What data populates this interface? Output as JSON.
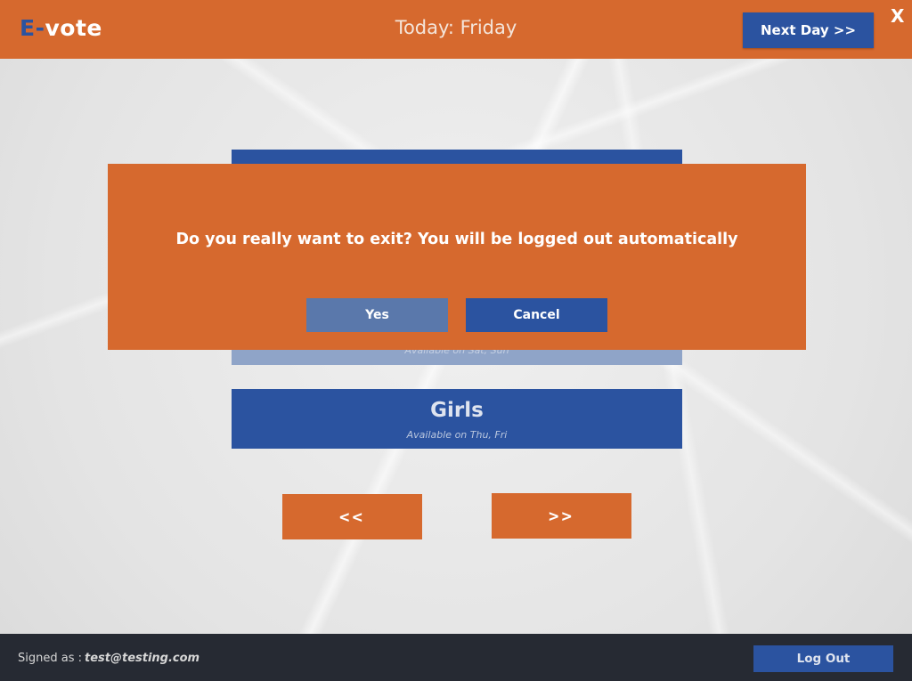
{
  "header": {
    "logo_prefix": "E",
    "logo_dash": "-",
    "logo_suffix": "vote",
    "today_label": "Today: Friday",
    "next_day_label": "Next Day >>",
    "close_label": "X"
  },
  "categories": {
    "top_partial": "",
    "faded_available": "Available on  Sat, Sun",
    "girls": {
      "title": "Girls",
      "available": "Available on  Thu, Fri"
    }
  },
  "nav": {
    "prev_label": "<<",
    "next_label": ">>"
  },
  "dialog": {
    "message": "Do you really want to exit? You will be logged out automatically",
    "yes_label": "Yes",
    "cancel_label": "Cancel"
  },
  "footer": {
    "signed_label": "Signed as :",
    "email": "test@testing.com",
    "logout_label": "Log Out"
  },
  "colors": {
    "accent_orange": "#d6692e",
    "primary_blue": "#2b53a0",
    "footer_dark": "#262a33"
  }
}
